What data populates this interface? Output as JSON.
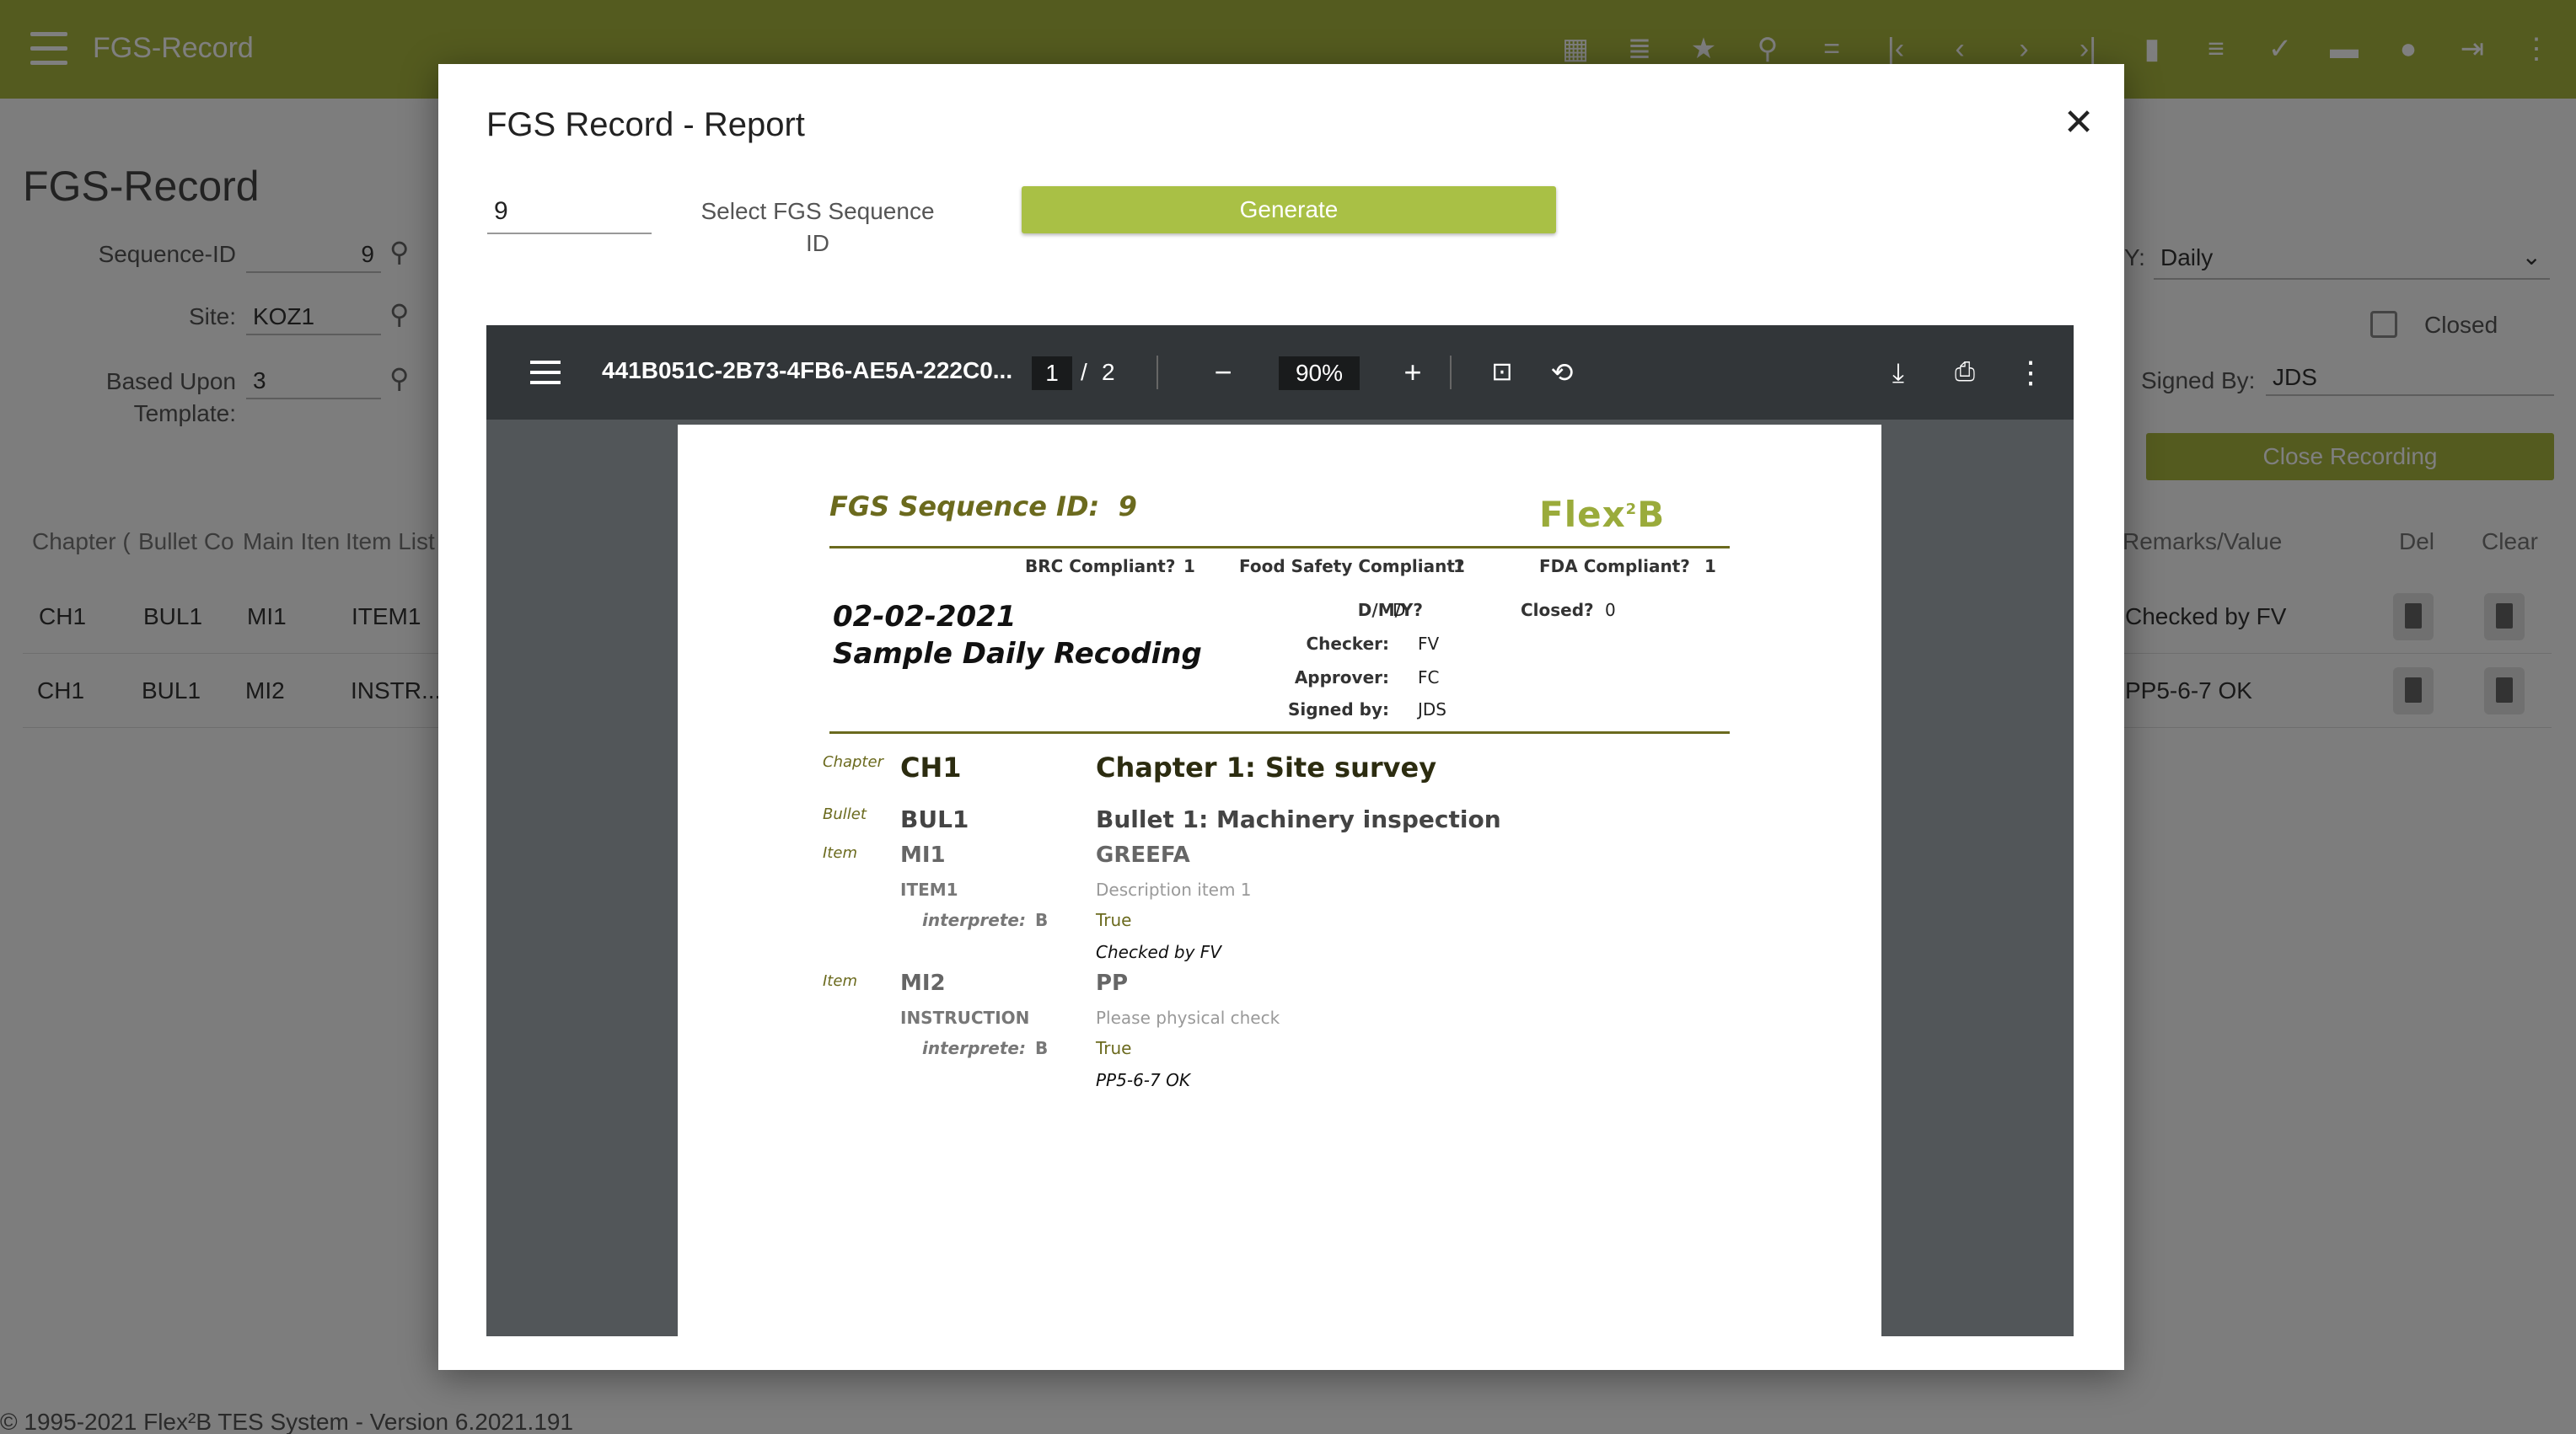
{
  "app": {
    "title": "FGS-Record",
    "page_heading": "FGS-Record",
    "footer": "© 1995-2021 Flex²B TES System - Version 6.2021.191"
  },
  "form": {
    "sequence_label": "Sequence-ID",
    "sequence_value": "9",
    "site_label": "Site:",
    "site_value": "KOZ1",
    "template_label": "Based Upon Template:",
    "template_value": "3",
    "period_label": "Y:",
    "period_value": "Daily",
    "closed_label": "Closed",
    "signed_label": "Signed By:",
    "signed_value": "JDS",
    "close_recording": "Close Recording"
  },
  "table": {
    "headers": [
      "Chapter (",
      "Bullet Co",
      "Main Iten",
      "Item List"
    ],
    "right_headers": [
      "Remarks/Value",
      "Del",
      "Clear"
    ],
    "rows": [
      {
        "chapter": "CH1",
        "bullet": "BUL1",
        "main": "MI1",
        "item": "ITEM1",
        "remarks": "Checked by FV"
      },
      {
        "chapter": "CH1",
        "bullet": "BUL1",
        "main": "MI2",
        "item": "INSTR...",
        "remarks": "PP5-6-7 OK"
      }
    ]
  },
  "modal": {
    "title": "FGS Record - Report",
    "sequence_input": "9",
    "hint": "Select FGS Sequence ID",
    "generate": "Generate"
  },
  "viewer": {
    "filename": "441B051C-2B73-4FB6-AE5A-222C0...",
    "page_current": "1",
    "page_sep": "/",
    "page_total": "2",
    "zoom": "90%"
  },
  "report": {
    "seq_label": "FGS Sequence ID:",
    "seq_value": "9",
    "logo": "FlexB",
    "logo_sup": "2",
    "brc_label": "BRC Compliant?",
    "brc_value": "1",
    "food_label": "Food Safety Compliant?",
    "food_value": "1",
    "fda_label": "FDA Compliant?",
    "fda_value": "1",
    "date": "02-02-2021",
    "name": "Sample Daily Recoding",
    "dmy_label": "D/M/Y?",
    "dmy_value": "D",
    "closed_label": "Closed?",
    "closed_value": "0",
    "checker_label": "Checker:",
    "checker_value": "FV",
    "approver_label": "Approver:",
    "approver_value": "FC",
    "signed_label": "Signed by:",
    "signed_value": "JDS",
    "chapter_lbl": "Chapter",
    "chapter_code": "CH1",
    "chapter_title": "Chapter 1: Site survey",
    "bullet_lbl": "Bullet",
    "bullet_code": "BUL1",
    "bullet_title": "Bullet 1: Machinery inspection",
    "items": [
      {
        "lbl": "Item",
        "code": "MI1",
        "name": "GREEFA",
        "sub": "ITEM1",
        "desc": "Description item 1",
        "interp_label": "interprete:",
        "interp_value": "B",
        "result": "True",
        "remark": "Checked by FV"
      },
      {
        "lbl": "Item",
        "code": "MI2",
        "name": "PP",
        "sub": "INSTRUCTION",
        "desc": "Please physical check",
        "interp_label": "interprete:",
        "interp_value": "B",
        "result": "True",
        "remark": "PP5-6-7 OK"
      }
    ]
  },
  "icons": {
    "toolbar": [
      "calendar-icon",
      "list-icon",
      "star-icon",
      "search-icon",
      "equals-icon",
      "first-page-icon",
      "prev-icon",
      "next-icon",
      "last-page-icon",
      "document-icon",
      "notes-icon",
      "check-icon",
      "trash-icon",
      "info-icon",
      "exit-icon",
      "more-icon"
    ]
  },
  "colors": {
    "brand": "#a9b63e",
    "button": "#a9c045",
    "report_accent": "#6b6a1e",
    "viewer_bar": "#323639",
    "viewer_bg": "#525659"
  }
}
